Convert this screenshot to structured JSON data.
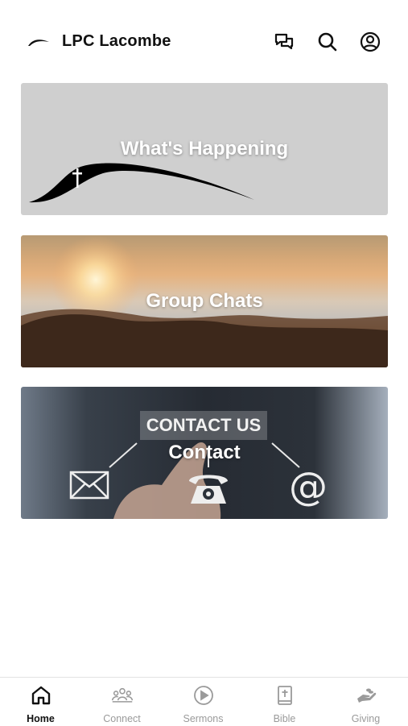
{
  "header": {
    "title": "LPC Lacombe",
    "icons": [
      "chat-icon",
      "search-icon",
      "account-icon"
    ]
  },
  "cards": [
    {
      "label": "What's Happening"
    },
    {
      "label": "Group Chats"
    },
    {
      "label": "Contact",
      "banner": "CONTACT US"
    }
  ],
  "tabs": [
    {
      "label": "Home",
      "icon": "home-icon",
      "active": true
    },
    {
      "label": "Connect",
      "icon": "people-icon",
      "active": false
    },
    {
      "label": "Sermons",
      "icon": "play-icon",
      "active": false
    },
    {
      "label": "Bible",
      "icon": "bible-icon",
      "active": false
    },
    {
      "label": "Giving",
      "icon": "giving-icon",
      "active": false
    }
  ],
  "colors": {
    "accent": "#111111",
    "inactive": "#9a9a9a",
    "card1_bg": "#cfcfcf"
  }
}
